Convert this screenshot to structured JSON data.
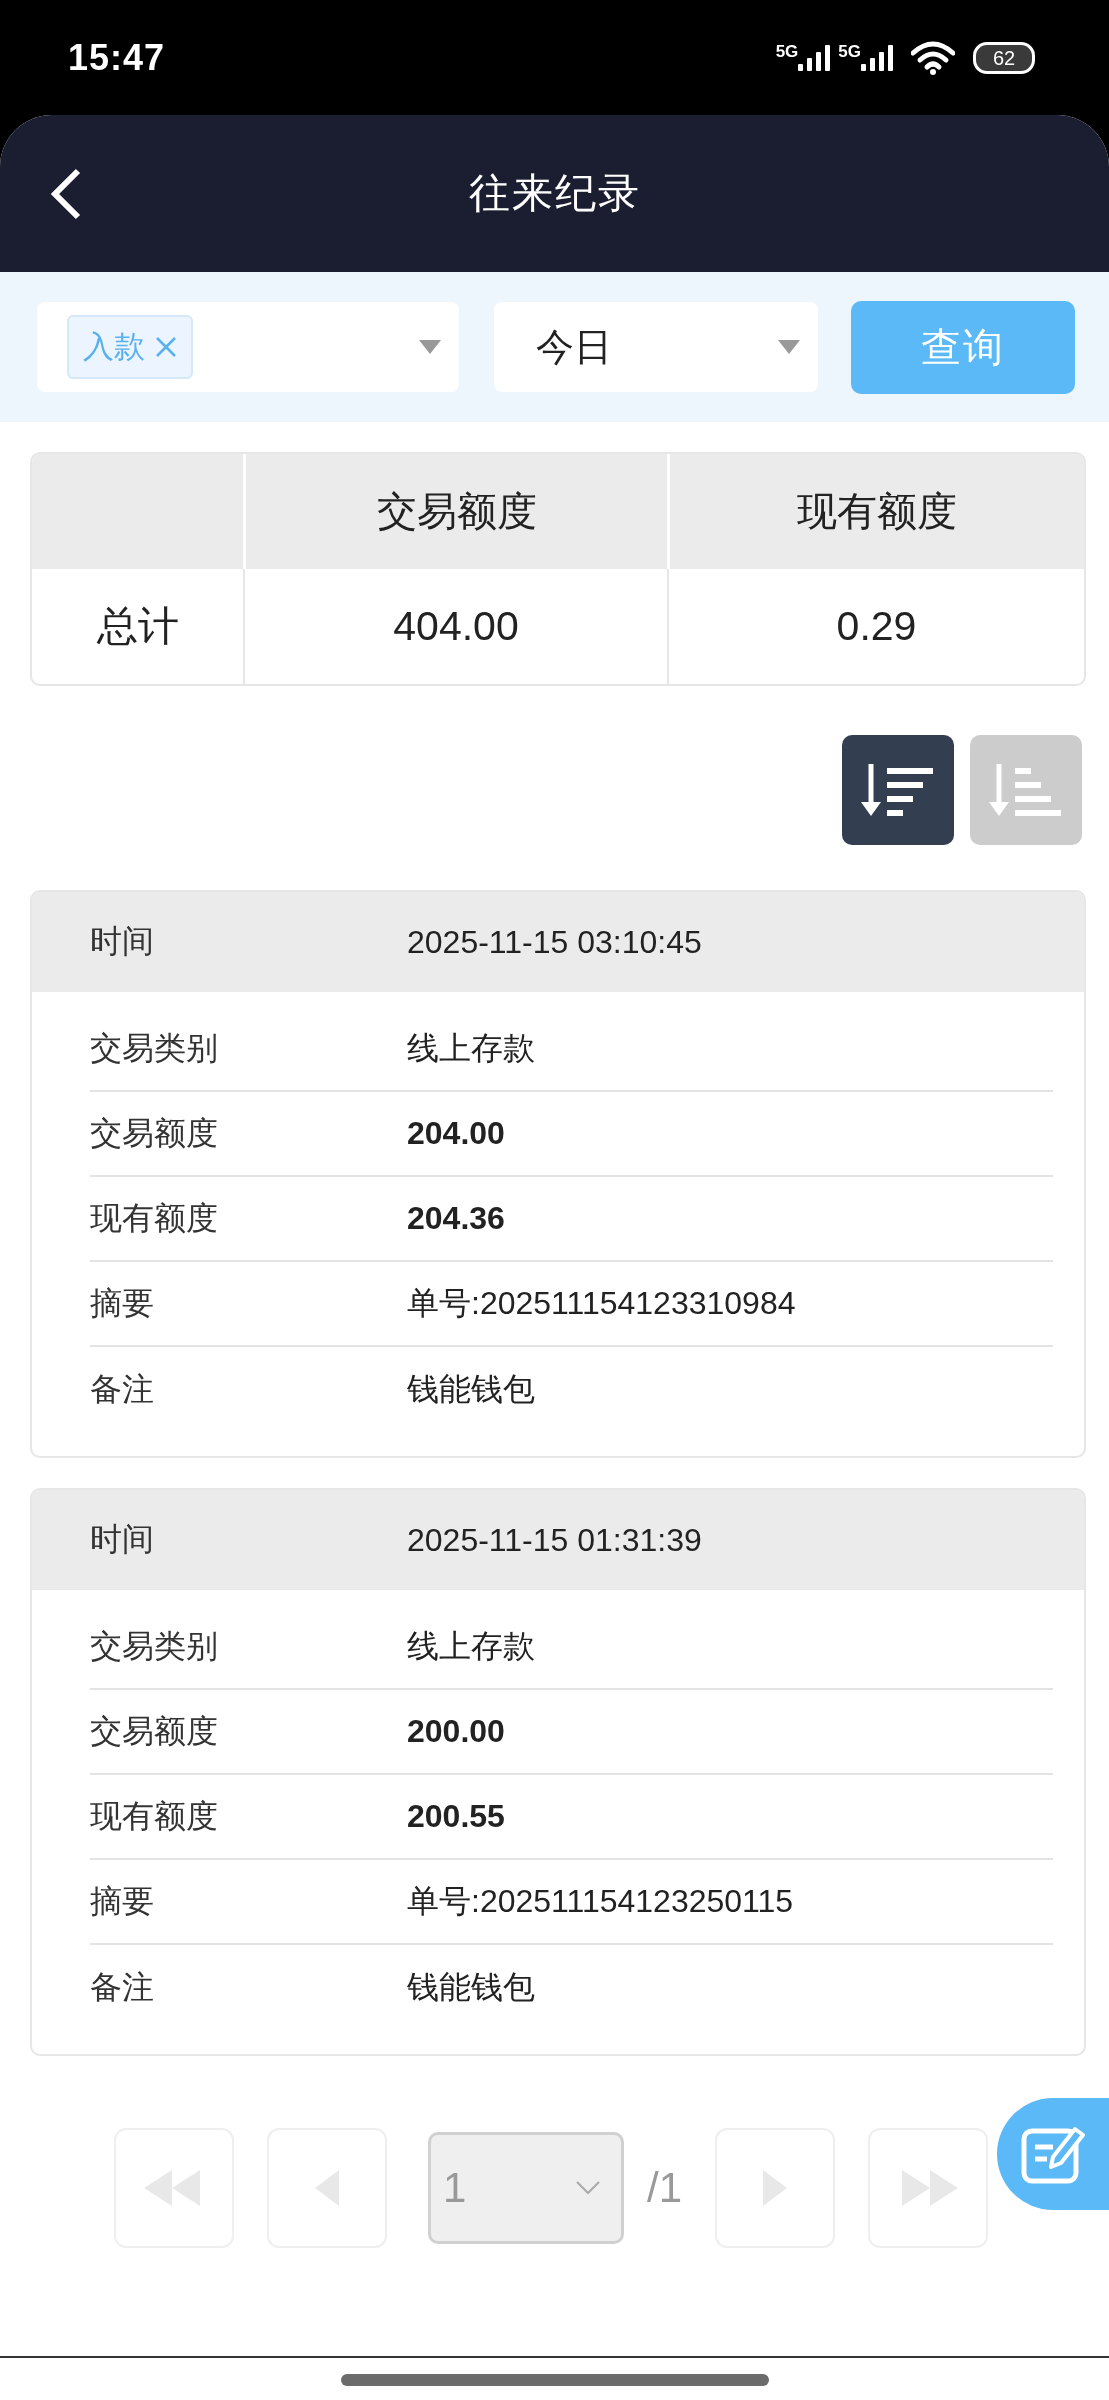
{
  "status_bar": {
    "time": "15:47",
    "networks": [
      "5G",
      "5G"
    ],
    "battery": "62"
  },
  "header": {
    "title": "往来纪录"
  },
  "filters": {
    "type_select": {
      "tags": [
        {
          "label": "入款"
        }
      ]
    },
    "period_select": {
      "value": "今日"
    },
    "query_button": "查询"
  },
  "summary": {
    "columns": [
      "交易额度",
      "现有额度"
    ],
    "rows": [
      {
        "label": "总计",
        "cells": [
          "404.00",
          "0.29"
        ]
      }
    ]
  },
  "sort_buttons": [
    {
      "kind": "descending",
      "selected": true
    },
    {
      "kind": "ascending",
      "selected": false
    }
  ],
  "records": [
    {
      "time_label": "时间",
      "time": "2025-11-15 03:10:45",
      "fields": [
        {
          "label": "交易类别",
          "value": "线上存款",
          "emphasis": false
        },
        {
          "label": "交易额度",
          "value": "204.00",
          "emphasis": true
        },
        {
          "label": "现有额度",
          "value": "204.36",
          "emphasis": true
        },
        {
          "label": "摘要",
          "value": "单号:202511154123310984",
          "emphasis": false
        },
        {
          "label": "备注",
          "value": "钱能钱包",
          "emphasis": false
        }
      ]
    },
    {
      "time_label": "时间",
      "time": "2025-11-15 01:31:39",
      "fields": [
        {
          "label": "交易类别",
          "value": "线上存款",
          "emphasis": false
        },
        {
          "label": "交易额度",
          "value": "200.00",
          "emphasis": true
        },
        {
          "label": "现有额度",
          "value": "200.55",
          "emphasis": true
        },
        {
          "label": "摘要",
          "value": "单号:202511154123250115",
          "emphasis": false
        },
        {
          "label": "备注",
          "value": "钱能钱包",
          "emphasis": false
        }
      ]
    }
  ],
  "pagination": {
    "buttons": [
      {
        "kind": "first",
        "disabled": true
      },
      {
        "kind": "previous",
        "disabled": true
      },
      {
        "kind": "next",
        "disabled": true
      },
      {
        "kind": "last",
        "disabled": true
      }
    ],
    "page_select": {
      "value": "1",
      "disabled": true
    },
    "total": "/1"
  }
}
